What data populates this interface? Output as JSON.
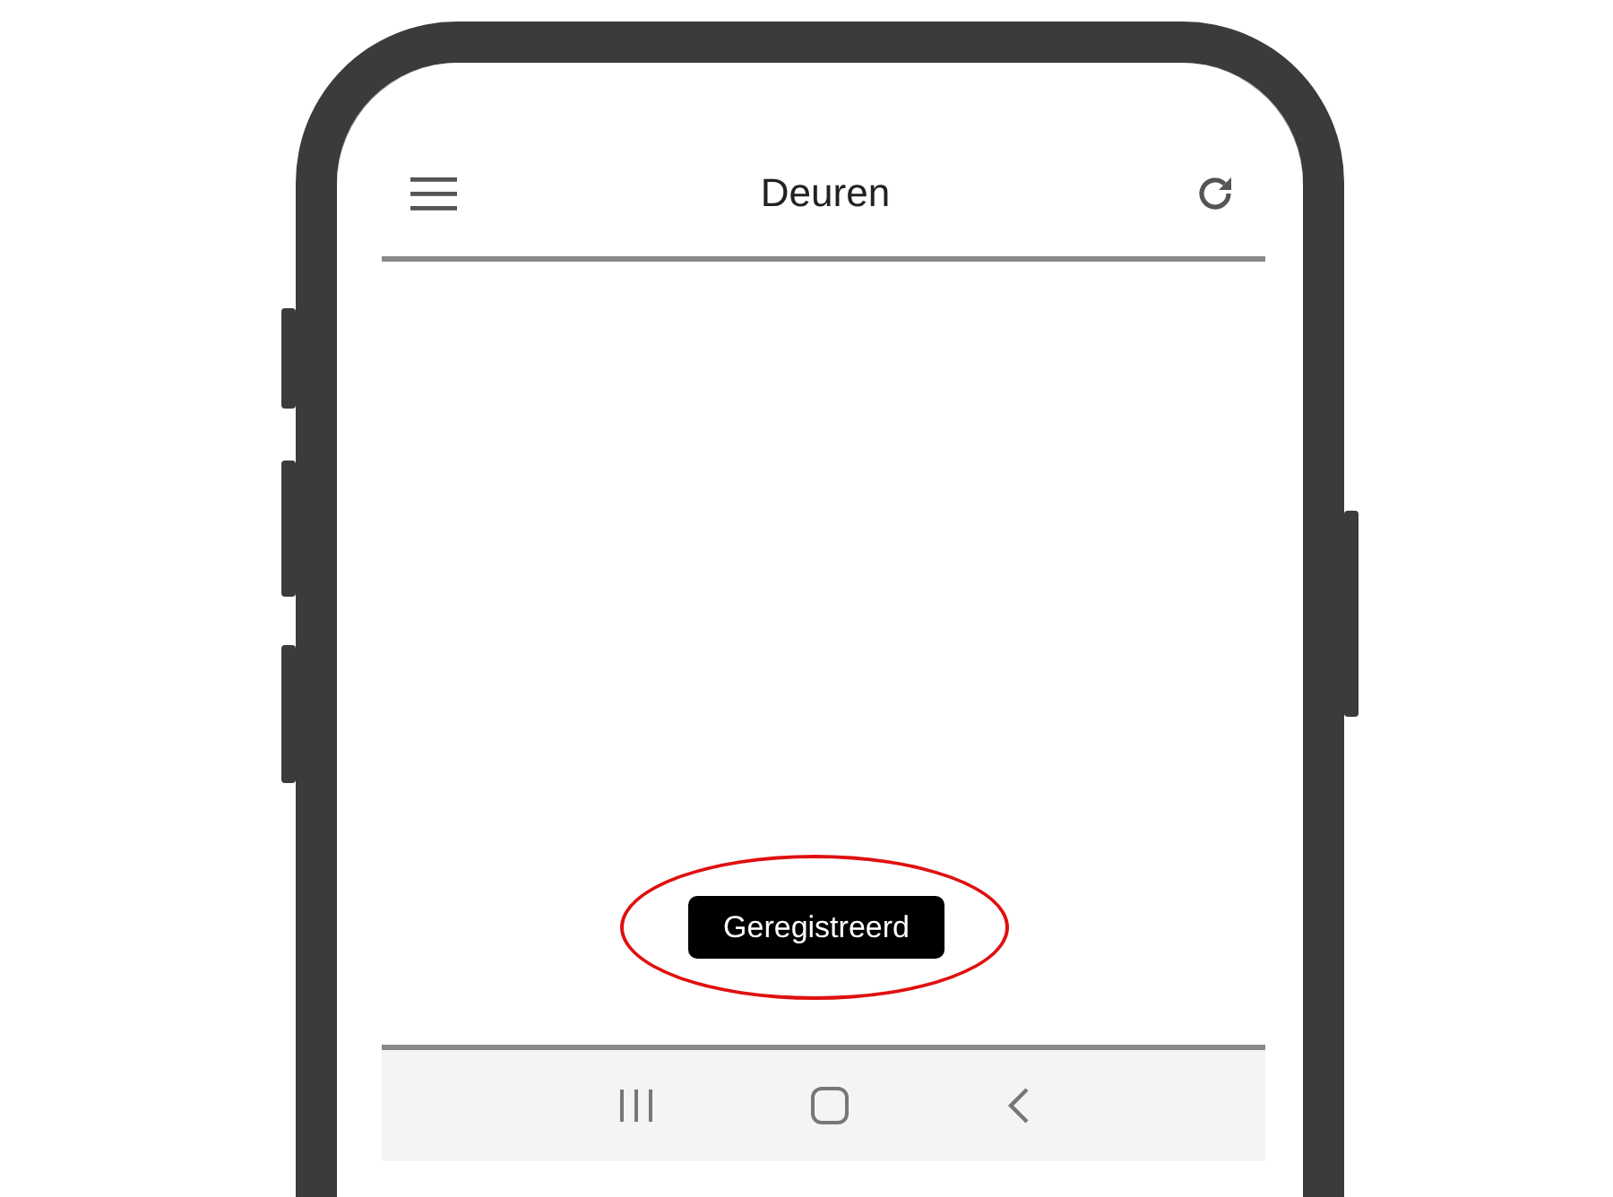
{
  "app_bar": {
    "title": "Deuren"
  },
  "toast": {
    "text": "Geregistreerd"
  }
}
